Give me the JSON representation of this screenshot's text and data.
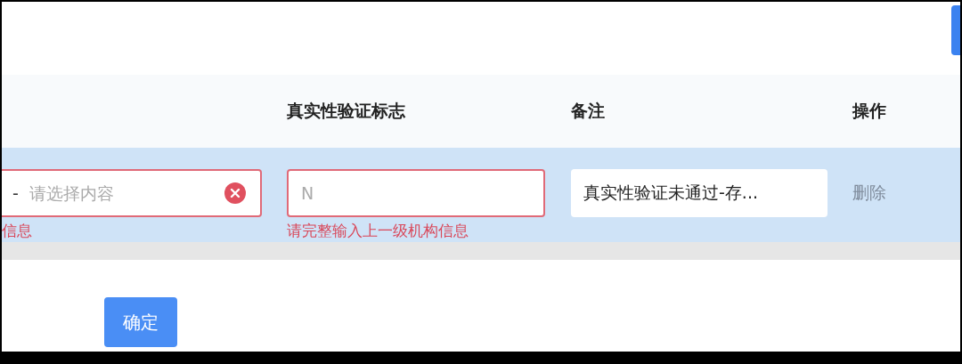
{
  "table": {
    "columns": [
      "真实性验证标志",
      "备注",
      "操作"
    ],
    "rows": [
      {
        "select": {
          "prefix": "-",
          "placeholder": "请选择内容",
          "error": "信息"
        },
        "flag": {
          "placeholder": "N",
          "error": "请完整输入上一级机构信息"
        },
        "remark": "真实性验证未通过-存...",
        "action": {
          "label": "删除",
          "disabled": true
        }
      }
    ]
  },
  "buttons": [
    "确定"
  ]
}
